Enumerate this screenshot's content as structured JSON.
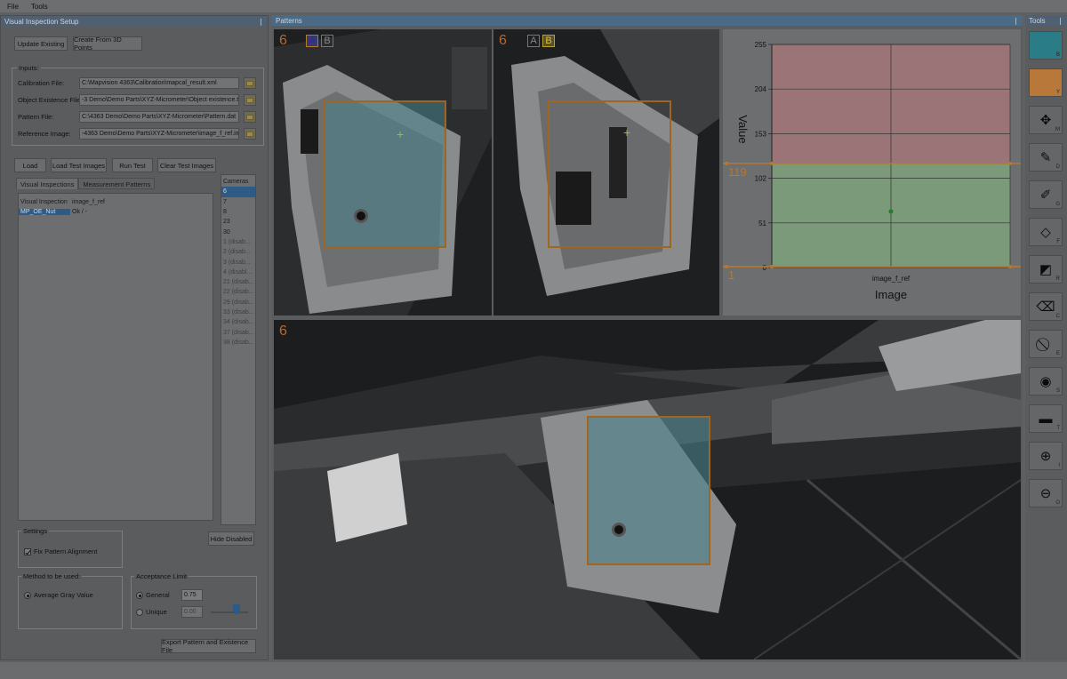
{
  "menu": {
    "file": "File",
    "tools": "Tools"
  },
  "left_panel": {
    "title": "Visual Inspection Setup",
    "pin": "❘",
    "update_existing": "Update Existing",
    "create_from_3d": "Create From 3D Points",
    "inputs_label": "Inputs:",
    "calibration_label": "Calibration File:",
    "calibration_value": "C:\\Mapvision 4363\\Calibration\\mapcal_result.xml",
    "existence_label": "Object Existence File:",
    "existence_value": "-3 Demo\\Demo Parts\\XYZ-Micrometer\\Object existence.txt",
    "pattern_label": "Pattern File:",
    "pattern_value": "C:\\4363 Demo\\Demo Parts\\XYZ-Micrometer\\Pattern.dat",
    "reference_label": "Reference Image:",
    "reference_value": "-4363 Demo\\Demo Parts\\XYZ-Micrometer\\image_f_ref.ima",
    "load": "Load",
    "load_test_images": "Load Test Images",
    "run_test": "Run Test",
    "clear_test_images": "Clear Test Images",
    "tab_visual": "Visual Inspections",
    "tab_measurement": "Measurement Patterns",
    "rows": [
      {
        "name": "Visual Inspection",
        "value": "image_f_ref",
        "selected": false
      },
      {
        "name": "MP_OE_Nut",
        "value": "Ok / -",
        "selected": true
      }
    ],
    "cameras_label": "Cameras",
    "cameras": [
      {
        "label": "6",
        "selected": true,
        "disabled": false
      },
      {
        "label": "7",
        "selected": false,
        "disabled": false
      },
      {
        "label": "8",
        "selected": false,
        "disabled": false
      },
      {
        "label": "23",
        "selected": false,
        "disabled": false
      },
      {
        "label": "30",
        "selected": false,
        "disabled": false
      },
      {
        "label": "1 (disab...",
        "selected": false,
        "disabled": true
      },
      {
        "label": "2 (disab...",
        "selected": false,
        "disabled": true
      },
      {
        "label": "3 (disab...",
        "selected": false,
        "disabled": true
      },
      {
        "label": "4 (disabl...",
        "selected": false,
        "disabled": true
      },
      {
        "label": "21 (disab...",
        "selected": false,
        "disabled": true
      },
      {
        "label": "22 (disab...",
        "selected": false,
        "disabled": true
      },
      {
        "label": "29 (disab...",
        "selected": false,
        "disabled": true
      },
      {
        "label": "33 (disab...",
        "selected": false,
        "disabled": true
      },
      {
        "label": "34 (disab...",
        "selected": false,
        "disabled": true
      },
      {
        "label": "37 (disab...",
        "selected": false,
        "disabled": true
      },
      {
        "label": "38 (disab...",
        "selected": false,
        "disabled": true
      }
    ],
    "hide_disabled": "Hide Disabled",
    "settings_label": "Settings",
    "fix_pattern": "Fix Pattern Alignment",
    "method_label": "Method to be used:",
    "average_gray": "Average Gray Value",
    "acceptance_label": "Acceptance Limit",
    "general_label": "General",
    "general_value": "0.75",
    "unique_label": "Unique",
    "unique_value": "0.00",
    "export": "Export Pattern and Existence File"
  },
  "patterns": {
    "title": "Patterns",
    "pin": "❘",
    "view1": {
      "cam": "6",
      "a": "A",
      "b": "B"
    },
    "view2": {
      "cam": "6",
      "a": "A",
      "b": "B"
    },
    "main_view": {
      "cam": "6"
    }
  },
  "chart_data": {
    "type": "scatter",
    "xlabel": "Image",
    "ylabel": "Value",
    "categories": [
      "image_f_ref"
    ],
    "yticks": [
      0,
      51,
      102,
      153,
      204,
      255
    ],
    "ylim": [
      0,
      255
    ],
    "series": [
      {
        "values": [
          64
        ]
      }
    ],
    "threshold_upper": 119,
    "threshold_lower": 1,
    "upper_label": "119",
    "lower_label": "1",
    "grid": true,
    "colors": {
      "reject": "#9a7476",
      "accept": "#7a9a7a",
      "threshold": "#b8782e",
      "point": "#2a7a2a"
    }
  },
  "tools": {
    "title": "Tools",
    "pin": "❘",
    "items": [
      {
        "name": "color-b-swatch",
        "key": "B",
        "glyph": ""
      },
      {
        "name": "color-y-swatch",
        "key": "Y",
        "glyph": ""
      },
      {
        "name": "move-tool-button",
        "key": "M",
        "glyph": "✥"
      },
      {
        "name": "draw-tool-button",
        "key": "D",
        "glyph": "✎"
      },
      {
        "name": "brush-tool-button",
        "key": "G",
        "glyph": "✐"
      },
      {
        "name": "fill-tool-button",
        "key": "F",
        "glyph": "◇"
      },
      {
        "name": "rect-tool-button",
        "key": "R",
        "glyph": "◩"
      },
      {
        "name": "clear-tool-button",
        "key": "C",
        "glyph": "⌫"
      },
      {
        "name": "erase-tool-button",
        "key": "E",
        "glyph": "⃠"
      },
      {
        "name": "show-tool-button",
        "key": "S",
        "glyph": "◉"
      },
      {
        "name": "gradient-tool-button",
        "key": "T",
        "glyph": "▬"
      },
      {
        "name": "zoom-in-button",
        "key": "I",
        "glyph": "⊕"
      },
      {
        "name": "zoom-out-button",
        "key": "O",
        "glyph": "⊖"
      }
    ],
    "colors": {
      "b": "#2a7c86",
      "y": "#b8783a"
    }
  }
}
